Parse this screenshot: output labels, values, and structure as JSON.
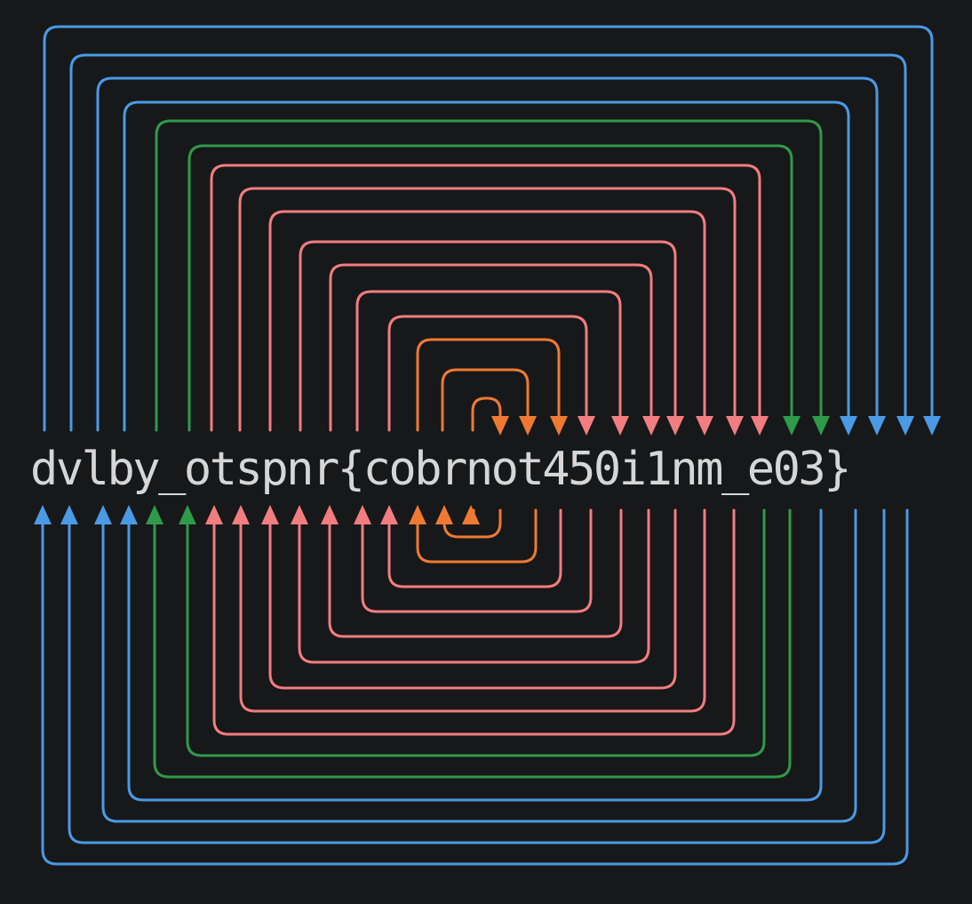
{
  "text": "dvlby_otspnr{cobrnot450i1nm_e03}",
  "colors": {
    "background": "#17181a",
    "text": "#d6d6d6",
    "blue": "#4a9ae6",
    "green": "#2f9a4a",
    "pink": "#f27d80",
    "orange": "#ee7a32"
  },
  "arrow_groups": [
    {
      "name": "blue",
      "color_key": "blue",
      "count": 4
    },
    {
      "name": "green",
      "color_key": "green",
      "count": 2
    },
    {
      "name": "pink",
      "color_key": "pink",
      "count": 7
    },
    {
      "name": "orange",
      "color_key": "orange",
      "count": 3
    }
  ]
}
